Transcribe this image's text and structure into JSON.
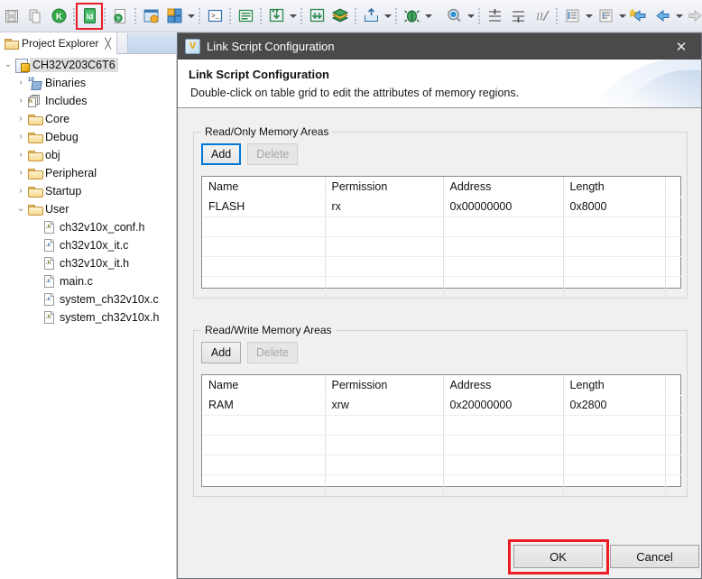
{
  "toolbar": {
    "items": [
      {
        "name": "save-icon",
        "glyph": "save"
      },
      {
        "name": "copy-icon",
        "glyph": "copy"
      },
      {
        "name": "build-project-icon",
        "glyph": "k"
      },
      {
        "name": "link-script-configuration-icon",
        "glyph": "ld",
        "highlighted": true
      },
      {
        "name": "help-document-icon",
        "glyph": "doc-q"
      },
      {
        "name": "configure-icon",
        "glyph": "window-gear"
      },
      {
        "name": "perspective-icon",
        "glyph": "squares"
      },
      {
        "name": "terminal-icon",
        "glyph": "terminal"
      },
      {
        "name": "console-icon",
        "glyph": "console"
      },
      {
        "name": "download-icon",
        "glyph": "download"
      },
      {
        "name": "download-all-icon",
        "glyph": "download2"
      },
      {
        "name": "books-icon",
        "glyph": "books"
      },
      {
        "name": "upload-icon",
        "glyph": "upload"
      },
      {
        "name": "debug-icon",
        "glyph": "bug"
      },
      {
        "name": "search-icon",
        "glyph": "magnifier"
      },
      {
        "name": "next-annotation-icon",
        "glyph": "ann1"
      },
      {
        "name": "previous-annotation-icon",
        "glyph": "ann2"
      },
      {
        "name": "last-edit-location-icon",
        "glyph": "ann3"
      },
      {
        "name": "back-to-icon",
        "glyph": "indent1"
      },
      {
        "name": "forward-to-icon",
        "glyph": "indent2"
      },
      {
        "name": "back-history-icon",
        "glyph": "arrow-left-star"
      },
      {
        "name": "previous-icon",
        "glyph": "arrow-left"
      },
      {
        "name": "next-icon",
        "glyph": "arrow-right"
      },
      {
        "name": "undo-icon",
        "glyph": "undo"
      },
      {
        "name": "redo-icon",
        "glyph": "redo"
      }
    ]
  },
  "project_explorer": {
    "tab_label": "Project Explorer",
    "close_glyph": "╳",
    "tree": [
      {
        "label": "CH32V203C6T6",
        "icon": "project-icon",
        "twisty": "⌄",
        "indent": 0,
        "selected": true
      },
      {
        "label": "Binaries",
        "icon": "binaries-icon",
        "twisty": "›",
        "indent": 1,
        "selected": false
      },
      {
        "label": "Includes",
        "icon": "includes-icon",
        "twisty": "›",
        "indent": 1,
        "selected": false
      },
      {
        "label": "Core",
        "icon": "folder-icon",
        "twisty": "›",
        "indent": 1,
        "selected": false
      },
      {
        "label": "Debug",
        "icon": "folder-icon",
        "twisty": "›",
        "indent": 1,
        "selected": false
      },
      {
        "label": "obj",
        "icon": "folder-icon",
        "twisty": "›",
        "indent": 1,
        "selected": false
      },
      {
        "label": "Peripheral",
        "icon": "folder-icon",
        "twisty": "›",
        "indent": 1,
        "selected": false
      },
      {
        "label": "Startup",
        "icon": "folder-icon",
        "twisty": "›",
        "indent": 1,
        "selected": false
      },
      {
        "label": "User",
        "icon": "folder-icon",
        "twisty": "⌄",
        "indent": 1,
        "selected": false
      },
      {
        "label": "ch32v10x_conf.h",
        "icon": "header-file-icon",
        "ext": ".h",
        "twisty": "",
        "indent": 2,
        "selected": false
      },
      {
        "label": "ch32v10x_it.c",
        "icon": "source-file-icon",
        "ext": ".c",
        "twisty": "",
        "indent": 2,
        "selected": false
      },
      {
        "label": "ch32v10x_it.h",
        "icon": "header-file-icon",
        "ext": ".h",
        "twisty": "",
        "indent": 2,
        "selected": false
      },
      {
        "label": "main.c",
        "icon": "source-file-icon",
        "ext": ".c",
        "twisty": "",
        "indent": 2,
        "selected": false
      },
      {
        "label": "system_ch32v10x.c",
        "icon": "source-file-icon",
        "ext": ".c",
        "twisty": "",
        "indent": 2,
        "selected": false
      },
      {
        "label": "system_ch32v10x.h",
        "icon": "header-file-icon",
        "ext": ".h",
        "twisty": "",
        "indent": 2,
        "selected": false
      }
    ]
  },
  "dialog": {
    "window_title": "Link Script Configuration",
    "title_icon_letter": "V",
    "close_glyph": "✕",
    "heading": "Link Script Configuration",
    "description": "Double-click on table grid to edit the attributes of memory regions.",
    "readonly_group": {
      "title": "Read/Only Memory Areas",
      "add_label": "Add",
      "delete_label": "Delete",
      "add_focused": true,
      "delete_disabled": true,
      "columns": [
        "Name",
        "Permission",
        "Address",
        "Length",
        ""
      ],
      "rows": [
        [
          "FLASH",
          "rx",
          "0x00000000",
          "0x8000",
          ""
        ],
        [
          "",
          "",
          "",
          "",
          ""
        ],
        [
          "",
          "",
          "",
          "",
          ""
        ],
        [
          "",
          "",
          "",
          "",
          ""
        ],
        [
          "",
          "",
          "",
          "",
          ""
        ]
      ]
    },
    "readwrite_group": {
      "title": "Read/Write Memory Areas",
      "add_label": "Add",
      "delete_label": "Delete",
      "add_focused": false,
      "delete_disabled": true,
      "columns": [
        "Name",
        "Permission",
        "Address",
        "Length",
        ""
      ],
      "rows": [
        [
          "RAM",
          "xrw",
          "0x20000000",
          "0x2800",
          ""
        ],
        [
          "",
          "",
          "",
          "",
          ""
        ],
        [
          "",
          "",
          "",
          "",
          ""
        ],
        [
          "",
          "",
          "",
          "",
          ""
        ],
        [
          "",
          "",
          "",
          "",
          ""
        ]
      ]
    },
    "ok_label": "OK",
    "cancel_label": "Cancel",
    "ok_highlighted": true
  },
  "colors": {
    "titlebar": "#4a4a4a",
    "dialog_bg": "#f0f0f0",
    "focus_blue": "#0078d7",
    "annotation_red": "#ec1c24",
    "tree_selection": "#dedede"
  }
}
